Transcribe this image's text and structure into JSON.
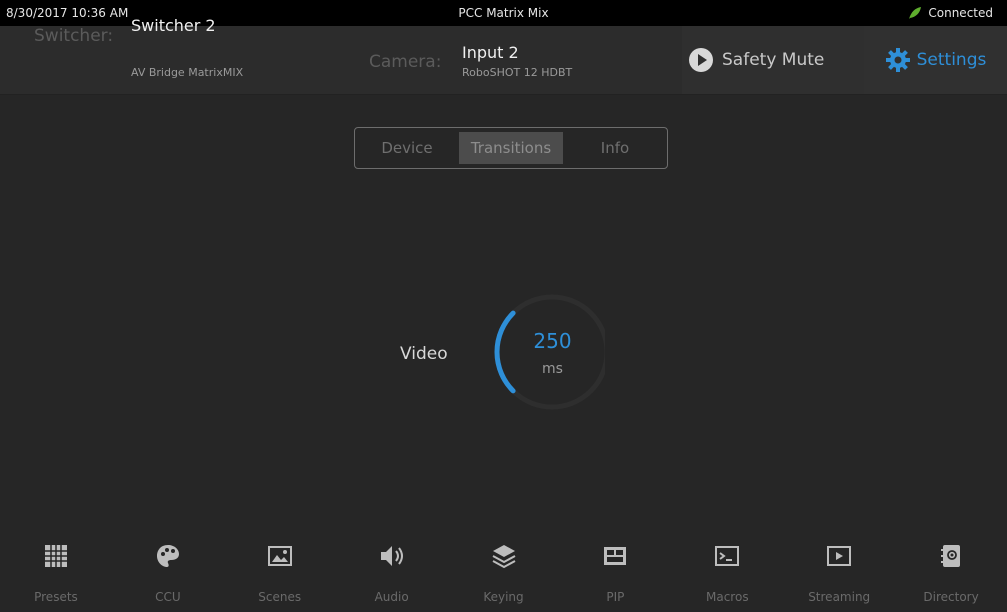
{
  "status": {
    "datetime": "8/30/2017 10:36 AM",
    "title": "PCC Matrix Mix",
    "connection": "Connected",
    "connection_color": "#5fae2e"
  },
  "header": {
    "switcher_label": "Switcher:",
    "switcher_name": "Switcher 2",
    "switcher_model": "AV Bridge MatrixMIX",
    "camera_label": "Camera:",
    "camera_name": "Input 2",
    "camera_model": "RoboSHOT 12 HDBT",
    "safety_mute_label": "Safety Mute",
    "settings_label": "Settings",
    "accent_color": "#2e8fd8"
  },
  "tabs": [
    {
      "label": "Device",
      "active": false
    },
    {
      "label": "Transitions",
      "active": true
    },
    {
      "label": "Info",
      "active": false
    }
  ],
  "transition": {
    "label": "Video",
    "value": "250",
    "unit": "ms",
    "dial_fraction": 0.25
  },
  "nav": [
    {
      "label": "Presets",
      "icon": "grid-icon"
    },
    {
      "label": "CCU",
      "icon": "palette-icon"
    },
    {
      "label": "Scenes",
      "icon": "picture-icon"
    },
    {
      "label": "Audio",
      "icon": "speaker-icon"
    },
    {
      "label": "Keying",
      "icon": "layers-icon"
    },
    {
      "label": "PIP",
      "icon": "pip-icon"
    },
    {
      "label": "Macros",
      "icon": "terminal-icon"
    },
    {
      "label": "Streaming",
      "icon": "play-box-icon"
    },
    {
      "label": "Directory",
      "icon": "address-book-icon"
    }
  ]
}
